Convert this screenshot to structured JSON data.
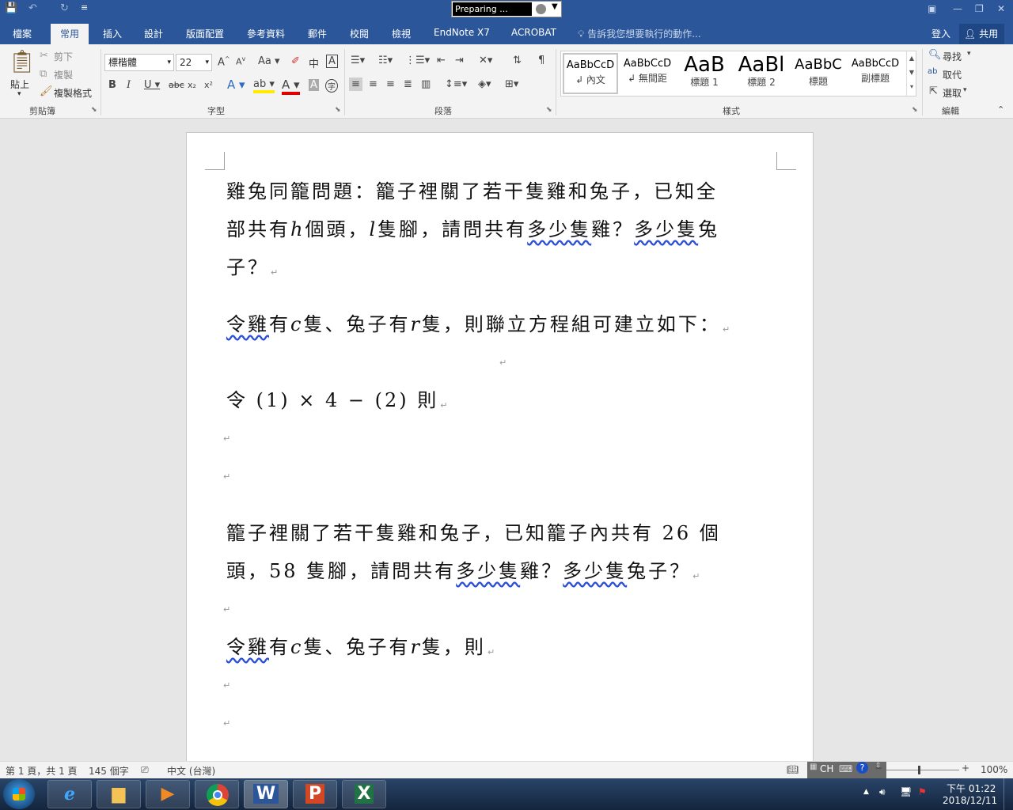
{
  "title_bar": {
    "preparing_text": "Preparing ...",
    "qa_save": "💾",
    "qa_undo": "↶",
    "qa_redo": "↻",
    "qa_more": "≡"
  },
  "tabs": [
    "檔案",
    "常用",
    "插入",
    "設計",
    "版面配置",
    "參考資料",
    "郵件",
    "校閱",
    "檢視",
    "EndNote X7",
    "ACROBAT"
  ],
  "tell_me": "告訴我您想要執行的動作...",
  "sign_in": "登入",
  "share": "共用",
  "clipboard": {
    "paste": "貼上",
    "cut": "剪下",
    "copy": "複製",
    "format_painter": "複製格式",
    "group": "剪貼簿"
  },
  "font": {
    "name": "標楷體",
    "size": "22",
    "group": "字型"
  },
  "paragraph": {
    "group": "段落"
  },
  "styles": {
    "group": "樣式",
    "items": [
      {
        "preview": "AaBbCcD",
        "name": "↲ 內文"
      },
      {
        "preview": "AaBbCcD",
        "name": "↲ 無間距"
      },
      {
        "preview": "AaB",
        "name": "標題 1"
      },
      {
        "preview": "AaBl",
        "name": "標題 2"
      },
      {
        "preview": "AaBbC",
        "name": "標題"
      },
      {
        "preview": "AaBbCcD",
        "name": "副標題"
      }
    ]
  },
  "editing": {
    "find": "尋找",
    "replace": "取代",
    "select": "選取",
    "group": "編輯"
  },
  "document": {
    "p1_l1": "雞兔同籠問題：籠子裡關了若干隻雞和兔子，已知全",
    "p1_l2_a": "部共有",
    "p1_l2_h": "h",
    "p1_l2_b": "個頭，",
    "p1_l2_l": "l",
    "p1_l2_c": "隻腳，請問共有",
    "p1_l2_d": "多少隻",
    "p1_l2_e": "雞？",
    "p1_l2_f": "多少隻",
    "p1_l2_g": "兔",
    "p1_l3": "子？",
    "p2_a": "令雞",
    "p2_b": "有",
    "p2_c": "c",
    "p2_d": "隻、兔子有",
    "p2_e": "r",
    "p2_f": "隻，則聯立方程組可建立如下：",
    "p3": "令 (1) × 4 − (2) 則",
    "p4_l1": "籠子裡關了若干隻雞和兔子，已知籠子內共有 26 個",
    "p4_l2_a": "頭，58 隻腳，請問共有",
    "p4_l2_b": "多少隻",
    "p4_l2_c": "雞？",
    "p4_l2_d": "多少隻",
    "p4_l2_e": "兔子？",
    "p5_a": "令雞",
    "p5_b": "有",
    "p5_c": "c",
    "p5_d": "隻、兔子有",
    "p5_e": "r",
    "p5_f": "隻，則",
    "para_mark": "↵"
  },
  "status": {
    "page": "第 1 頁，共 1 頁",
    "words": "145 個字",
    "language": "中文 (台灣)",
    "ime": "CH",
    "zoom": "100%"
  },
  "taskbar": {
    "time": "下午 01:22",
    "date": "2018/12/11"
  }
}
